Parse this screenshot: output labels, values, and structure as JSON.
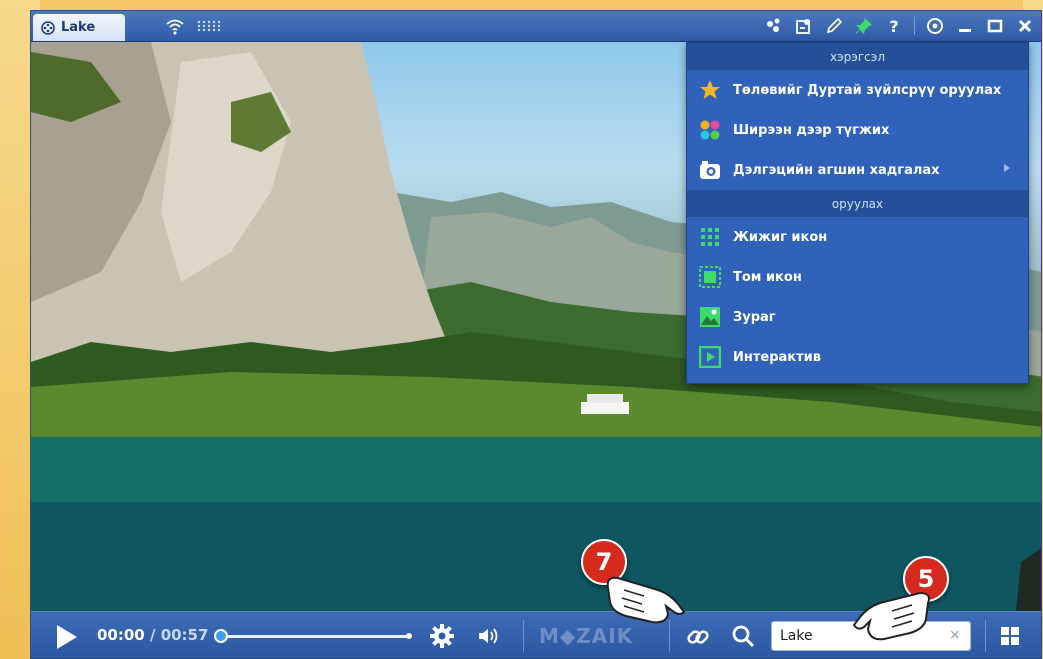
{
  "window": {
    "tab_label": "Lake"
  },
  "titlebar_icons": [
    "share-dots-icon",
    "puzzle-icon",
    "pencil-icon",
    "pin-icon",
    "help-icon",
    "eye-icon",
    "minimize-icon",
    "maximize-icon",
    "close-icon"
  ],
  "menu": {
    "section_tools": "хэрэгсэл",
    "items_tools": [
      {
        "label": "Төлөвийг Дуртай зүйлсрүү оруулах",
        "icon": "star-icon"
      },
      {
        "label": "Ширээн дээр түгжих",
        "icon": "color-dots-icon"
      },
      {
        "label": "Дэлгэцийн агшин хадгалах",
        "icon": "camera-icon",
        "has_submenu": true
      }
    ],
    "section_insert": "оруулах",
    "items_insert": [
      {
        "label": "Жижиг икон",
        "icon": "small-icon-grid-icon"
      },
      {
        "label": "Том икон",
        "icon": "large-icon-icon"
      },
      {
        "label": "Зураг",
        "icon": "image-icon"
      },
      {
        "label": "Интерактив",
        "icon": "play-box-icon"
      }
    ]
  },
  "player": {
    "current_time": "00:00",
    "separator": " / ",
    "duration": "00:57",
    "progress": 0,
    "brand": "M◆ZAIK",
    "search_value": "Lake",
    "search_clear": "×"
  },
  "callouts": [
    {
      "number": "7"
    },
    {
      "number": "5"
    }
  ],
  "colors": {
    "accent": "#2f62b8",
    "badge": "#d62a1f",
    "green_icon": "#3ddc6a"
  }
}
